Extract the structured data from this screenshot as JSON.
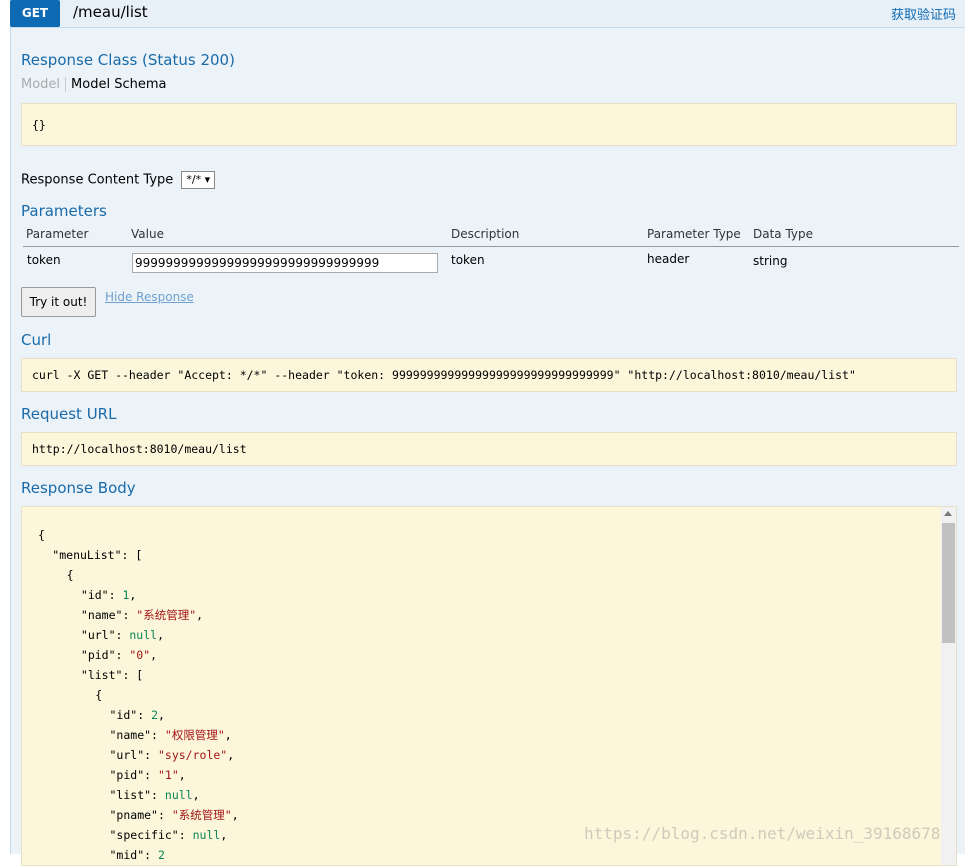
{
  "operation": {
    "method": "GET",
    "path": "/meau/list",
    "summary": "获取验证码"
  },
  "response_class": {
    "title": "Response Class (Status 200)",
    "tab_model": "Model",
    "tab_schema": "Model Schema",
    "schema": "{}"
  },
  "content_type": {
    "label": "Response Content Type",
    "selected": "*/*"
  },
  "parameters": {
    "title": "Parameters",
    "headers": [
      "Parameter",
      "Value",
      "Description",
      "Parameter Type",
      "Data Type"
    ],
    "rows": [
      {
        "name": "token",
        "value": "99999999999999999999999999999999",
        "description": "token",
        "param_type": "header",
        "data_type": "string"
      }
    ]
  },
  "actions": {
    "try_label": "Try it out!",
    "hide_label": "Hide Response"
  },
  "curl": {
    "title": "Curl",
    "command": "curl -X GET --header \"Accept: */*\" --header \"token: 99999999999999999999999999999999\" \"http://localhost:8010/meau/list\""
  },
  "request_url": {
    "title": "Request URL",
    "value": "http://localhost:8010/meau/list"
  },
  "response_body": {
    "title": "Response Body",
    "lines": [
      {
        "indent": 0,
        "parts": [
          {
            "t": "p",
            "v": "{"
          }
        ]
      },
      {
        "indent": 1,
        "parts": [
          {
            "t": "k",
            "v": "\"menuList\""
          },
          {
            "t": "p",
            "v": ": ["
          }
        ]
      },
      {
        "indent": 2,
        "parts": [
          {
            "t": "p",
            "v": "{"
          }
        ]
      },
      {
        "indent": 3,
        "parts": [
          {
            "t": "k",
            "v": "\"id\""
          },
          {
            "t": "p",
            "v": ": "
          },
          {
            "t": "n",
            "v": "1"
          },
          {
            "t": "p",
            "v": ","
          }
        ]
      },
      {
        "indent": 3,
        "parts": [
          {
            "t": "k",
            "v": "\"name\""
          },
          {
            "t": "p",
            "v": ": "
          },
          {
            "t": "s",
            "v": "\"系统管理\""
          },
          {
            "t": "p",
            "v": ","
          }
        ]
      },
      {
        "indent": 3,
        "parts": [
          {
            "t": "k",
            "v": "\"url\""
          },
          {
            "t": "p",
            "v": ": "
          },
          {
            "t": "n",
            "v": "null"
          },
          {
            "t": "p",
            "v": ","
          }
        ]
      },
      {
        "indent": 3,
        "parts": [
          {
            "t": "k",
            "v": "\"pid\""
          },
          {
            "t": "p",
            "v": ": "
          },
          {
            "t": "s",
            "v": "\"0\""
          },
          {
            "t": "p",
            "v": ","
          }
        ]
      },
      {
        "indent": 3,
        "parts": [
          {
            "t": "k",
            "v": "\"list\""
          },
          {
            "t": "p",
            "v": ": ["
          }
        ]
      },
      {
        "indent": 4,
        "parts": [
          {
            "t": "p",
            "v": "{"
          }
        ]
      },
      {
        "indent": 5,
        "parts": [
          {
            "t": "k",
            "v": "\"id\""
          },
          {
            "t": "p",
            "v": ": "
          },
          {
            "t": "n",
            "v": "2"
          },
          {
            "t": "p",
            "v": ","
          }
        ]
      },
      {
        "indent": 5,
        "parts": [
          {
            "t": "k",
            "v": "\"name\""
          },
          {
            "t": "p",
            "v": ": "
          },
          {
            "t": "s",
            "v": "\"权限管理\""
          },
          {
            "t": "p",
            "v": ","
          }
        ]
      },
      {
        "indent": 5,
        "parts": [
          {
            "t": "k",
            "v": "\"url\""
          },
          {
            "t": "p",
            "v": ": "
          },
          {
            "t": "s",
            "v": "\"sys/role\""
          },
          {
            "t": "p",
            "v": ","
          }
        ]
      },
      {
        "indent": 5,
        "parts": [
          {
            "t": "k",
            "v": "\"pid\""
          },
          {
            "t": "p",
            "v": ": "
          },
          {
            "t": "s",
            "v": "\"1\""
          },
          {
            "t": "p",
            "v": ","
          }
        ]
      },
      {
        "indent": 5,
        "parts": [
          {
            "t": "k",
            "v": "\"list\""
          },
          {
            "t": "p",
            "v": ": "
          },
          {
            "t": "n",
            "v": "null"
          },
          {
            "t": "p",
            "v": ","
          }
        ]
      },
      {
        "indent": 5,
        "parts": [
          {
            "t": "k",
            "v": "\"pname\""
          },
          {
            "t": "p",
            "v": ": "
          },
          {
            "t": "s",
            "v": "\"系统管理\""
          },
          {
            "t": "p",
            "v": ","
          }
        ]
      },
      {
        "indent": 5,
        "parts": [
          {
            "t": "k",
            "v": "\"specific\""
          },
          {
            "t": "p",
            "v": ": "
          },
          {
            "t": "n",
            "v": "null"
          },
          {
            "t": "p",
            "v": ","
          }
        ]
      },
      {
        "indent": 5,
        "parts": [
          {
            "t": "k",
            "v": "\"mid\""
          },
          {
            "t": "p",
            "v": ": "
          },
          {
            "t": "n",
            "v": "2"
          }
        ]
      }
    ]
  },
  "watermark": "https://blog.csdn.net/weixin_39168678",
  "colors": {
    "method_badge": "#0f6ab4",
    "section_title": "#1a6aa8",
    "panel_bg": "#ebf3f9",
    "code_bg": "#fcf6db"
  }
}
